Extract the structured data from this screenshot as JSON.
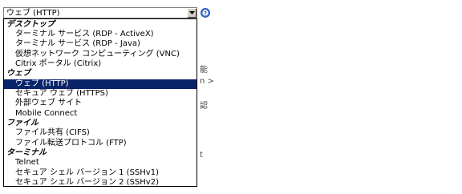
{
  "select": {
    "value": "ウェブ (HTTP)"
  },
  "help": {
    "icon": "help-icon"
  },
  "background_text": {
    "frag_1": "能",
    "frag_2": "n >",
    "frag_3": "認",
    "frag_4": "t"
  },
  "options": [
    {
      "type": "group",
      "label": "デスクトップ"
    },
    {
      "type": "option",
      "label": "ターミナル サービス (RDP - ActiveX)"
    },
    {
      "type": "option",
      "label": "ターミナル サービス (RDP - Java)"
    },
    {
      "type": "option",
      "label": "仮想ネットワーク コンピューティング (VNC)"
    },
    {
      "type": "option",
      "label": "Citrix ポータル (Citrix)"
    },
    {
      "type": "group",
      "label": "ウェブ"
    },
    {
      "type": "option",
      "label": "ウェブ (HTTP)",
      "selected": true
    },
    {
      "type": "option",
      "label": "セキュア ウェブ (HTTPS)"
    },
    {
      "type": "option",
      "label": "外部ウェブ サイト"
    },
    {
      "type": "option",
      "label": "Mobile Connect"
    },
    {
      "type": "group",
      "label": "ファイル"
    },
    {
      "type": "option",
      "label": "ファイル共有 (CIFS)"
    },
    {
      "type": "option",
      "label": "ファイル転送プロトコル (FTP)"
    },
    {
      "type": "group",
      "label": "ターミナル"
    },
    {
      "type": "option",
      "label": "Telnet"
    },
    {
      "type": "option",
      "label": "セキュア シェル バージョン 1 (SSHv1)"
    },
    {
      "type": "option",
      "label": "セキュア シェル バージョン 2 (SSHv2)"
    }
  ],
  "colors": {
    "selected_bg": "#0a246a",
    "selected_fg": "#ffffff",
    "help_icon": "#3b6fd8"
  }
}
